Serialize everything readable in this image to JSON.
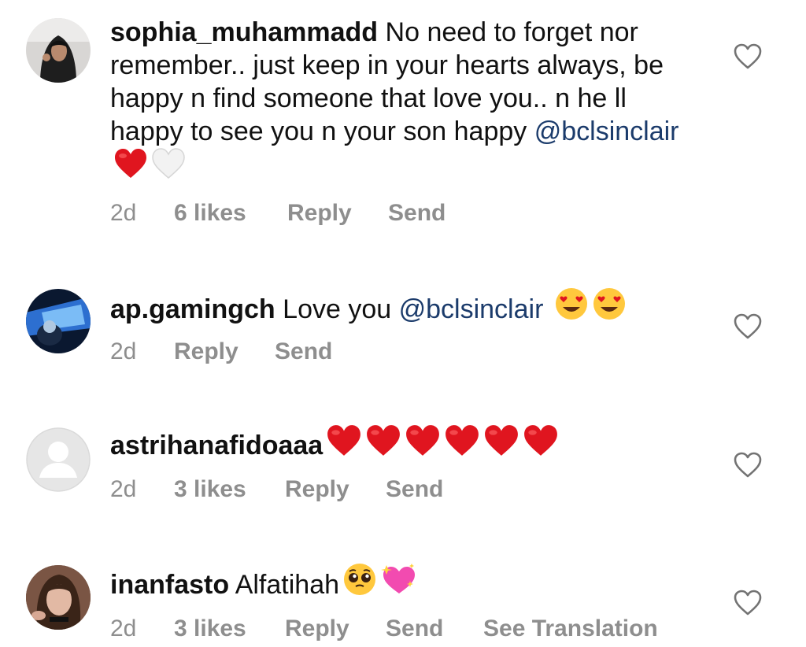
{
  "comments": [
    {
      "username": "sophia_muhammadd",
      "text": "No need to forget nor remember.. just keep in your hearts always, be happy n find someone that love you.. n he ll happy to see you n your son happy",
      "mention": "@bclsinclair",
      "emojis": [
        "red-heart",
        "white-heart"
      ],
      "time": "2d",
      "likes": "6 likes",
      "reply": "Reply",
      "send": "Send"
    },
    {
      "username": "ap.gamingch",
      "text": "Love you",
      "mention": "@bclsinclair",
      "emojis": [
        "heart-eyes",
        "heart-eyes"
      ],
      "time": "2d",
      "reply": "Reply",
      "send": "Send"
    },
    {
      "username": "astrihanafidoaaa",
      "text": "",
      "emojis": [
        "red-heart",
        "red-heart",
        "red-heart",
        "red-heart",
        "red-heart",
        "red-heart"
      ],
      "time": "2d",
      "likes": "3 likes",
      "reply": "Reply",
      "send": "Send"
    },
    {
      "username": "inanfasto",
      "text": "Alfatihah",
      "emojis": [
        "pleading-face",
        "sparkling-heart"
      ],
      "time": "2d",
      "likes": "3 likes",
      "reply": "Reply",
      "send": "Send",
      "see_translation": "See Translation"
    }
  ],
  "icons": {
    "like": "heart-outline-icon",
    "default_avatar": "person-silhouette-icon"
  },
  "colors": {
    "mention": "#1b3b6b",
    "meta": "#8e8e8e",
    "red_heart": "#e0151f"
  }
}
